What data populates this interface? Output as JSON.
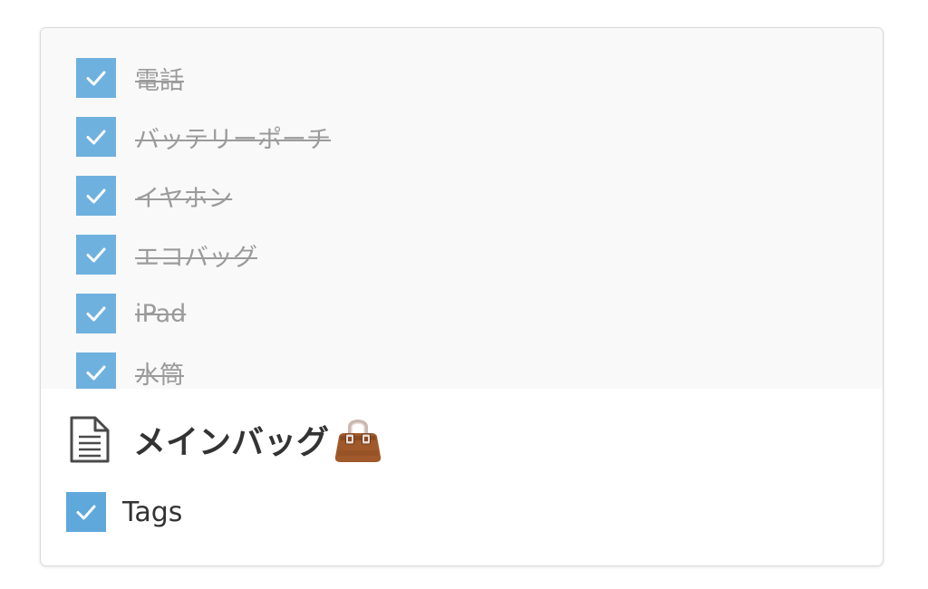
{
  "preview": {
    "items": [
      {
        "label": "電話",
        "checked": true
      },
      {
        "label": "バッテリーポーチ",
        "checked": true
      },
      {
        "label": "イヤホン",
        "checked": true
      },
      {
        "label": "エコバッグ",
        "checked": true
      },
      {
        "label": "iPad",
        "checked": true
      },
      {
        "label": "水筒",
        "checked": true
      }
    ]
  },
  "page": {
    "title": "メインバッグ",
    "title_emoji": "handbag-icon",
    "page_icon": "document-icon"
  },
  "properties": {
    "tags_label": "Tags",
    "tags_checked": true
  },
  "colors": {
    "checkbox": "#6fb1de",
    "completed_text": "#9b9b9b",
    "title_text": "#333333"
  }
}
